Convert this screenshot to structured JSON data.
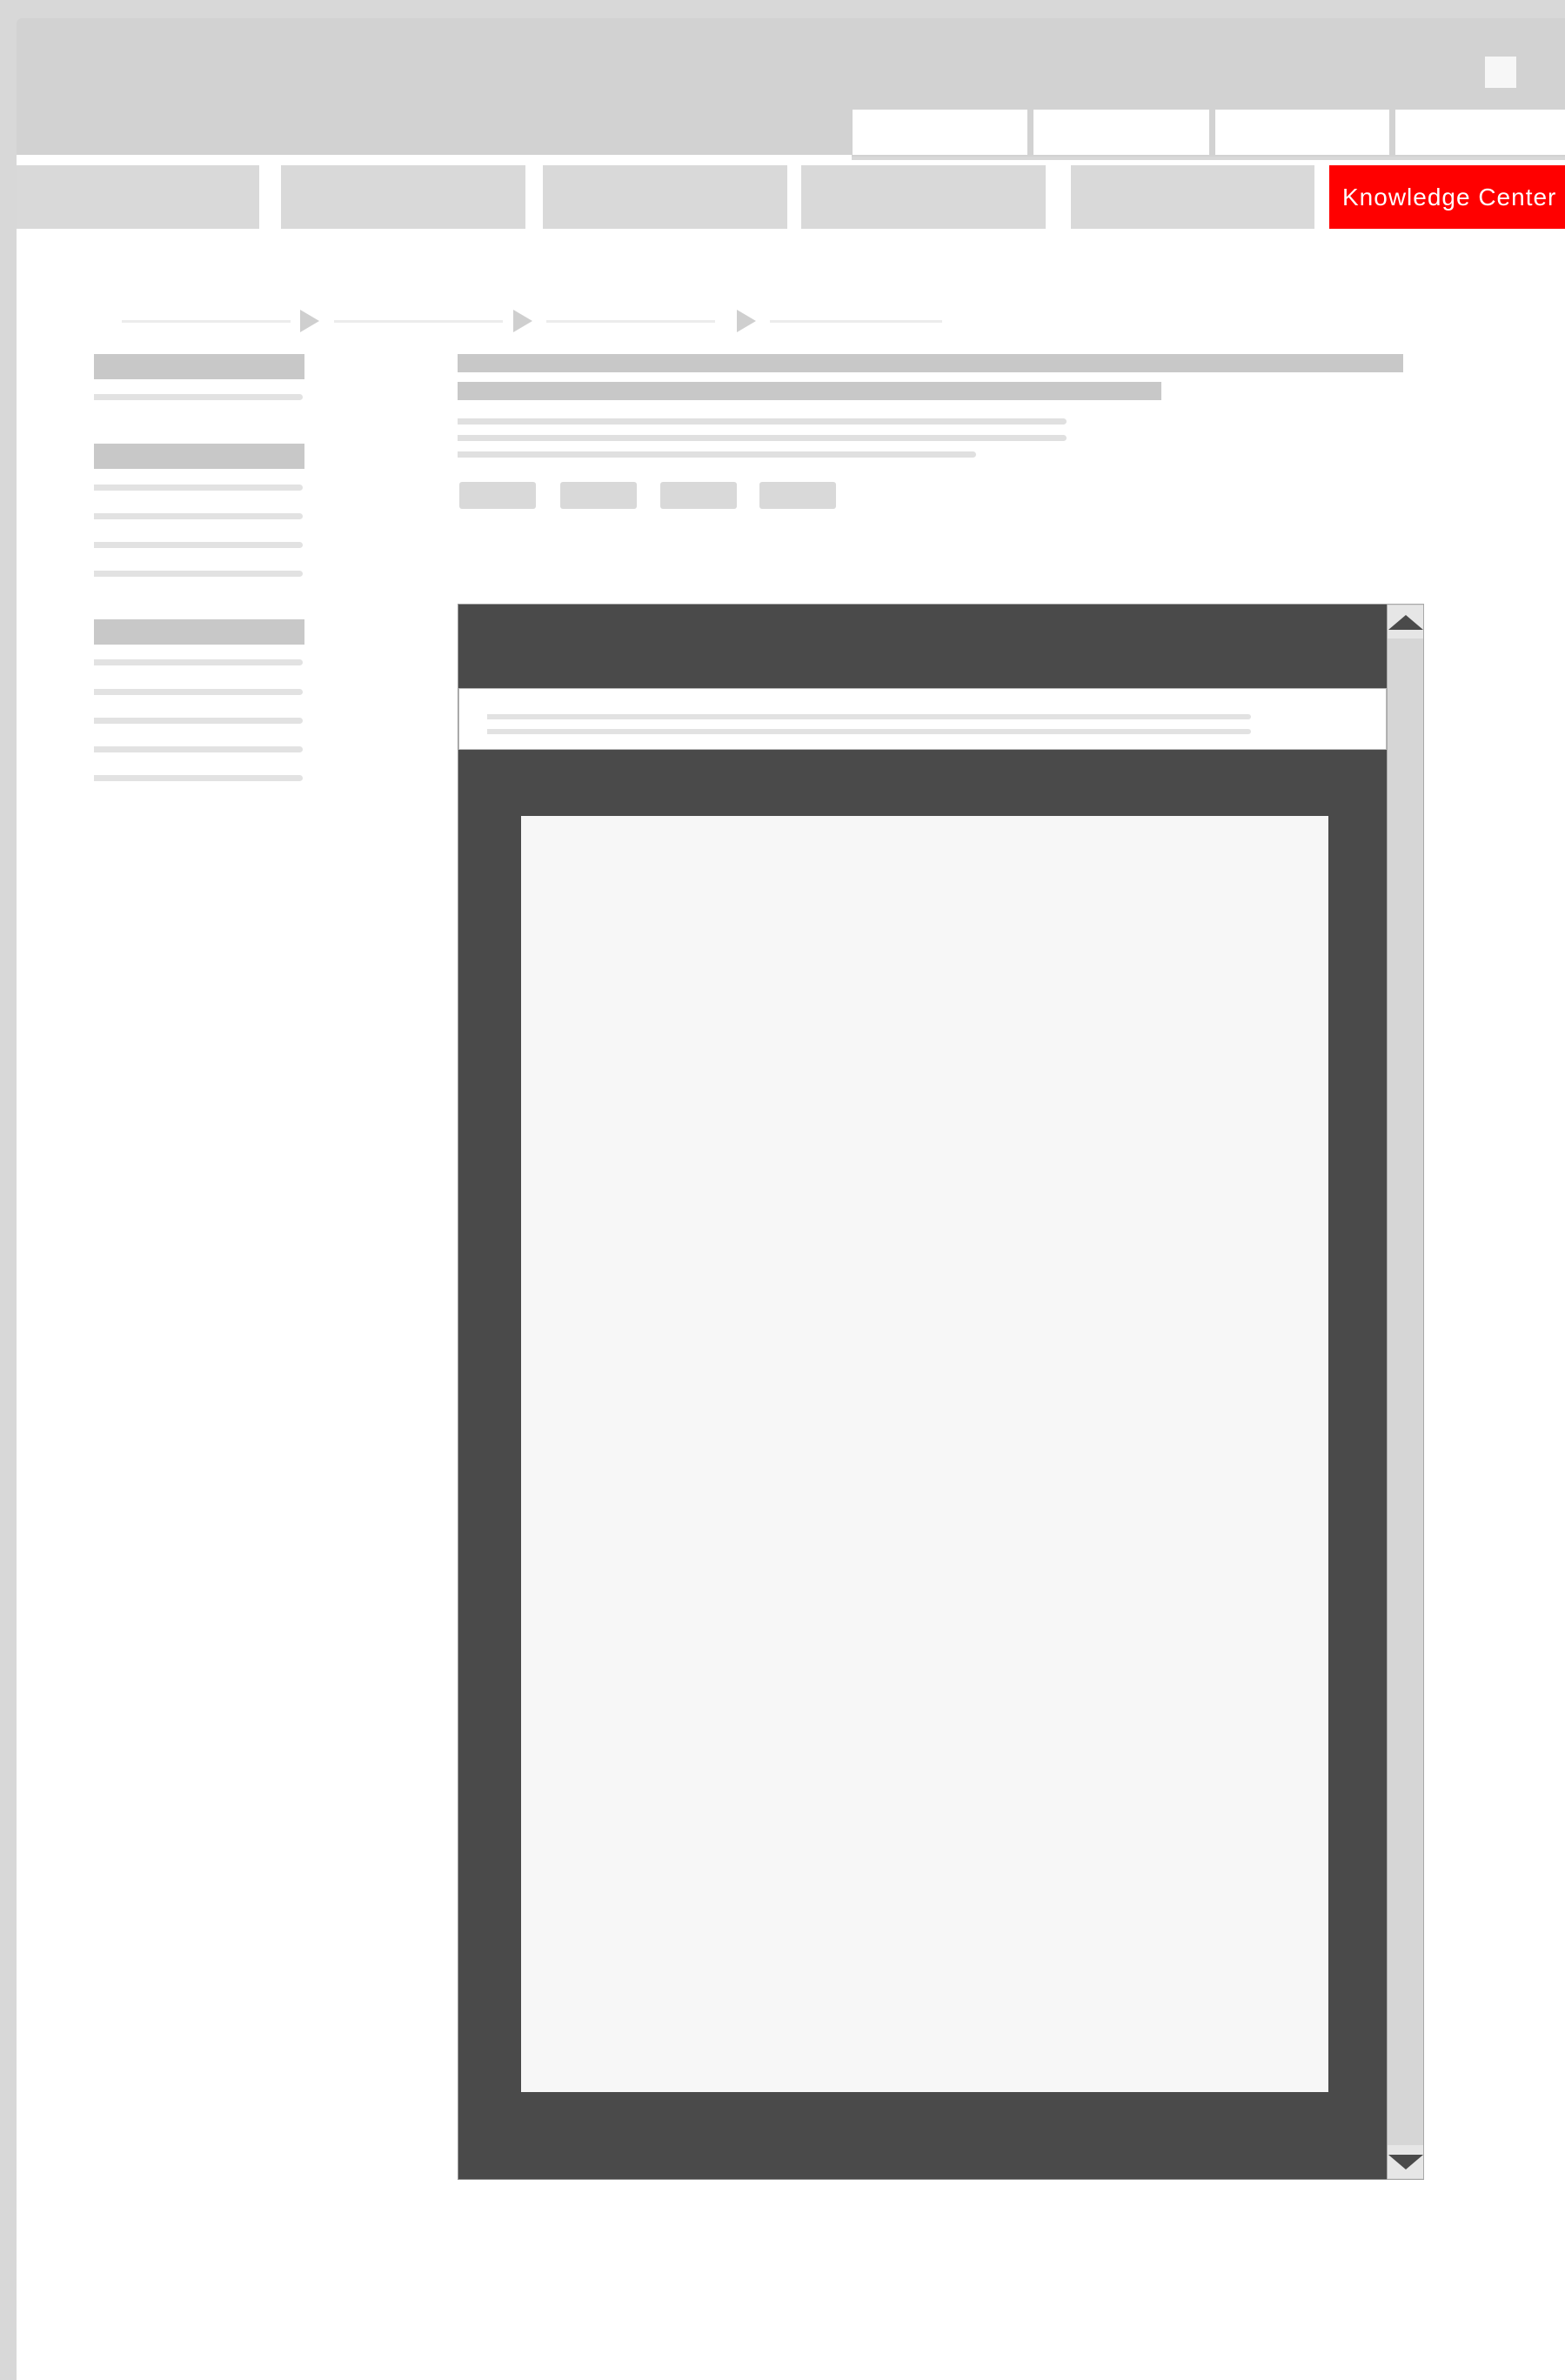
{
  "nav": {
    "active_label": "Knowledge Center",
    "accent_color": "#ff0000"
  },
  "viewer": {
    "background": "#4a4a4a",
    "page_color": "#f7f7f7"
  },
  "icons": {
    "breadcrumb_separator": "triangle-right-icon",
    "scroll_up": "triangle-up-icon",
    "scroll_down": "triangle-down-icon"
  }
}
